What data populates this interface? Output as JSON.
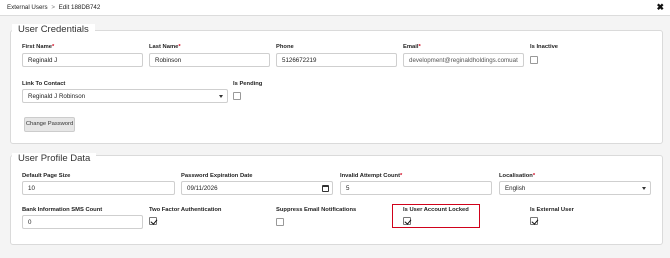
{
  "breadcrumb": {
    "root": "External Users",
    "separator": ">",
    "current": "Edit 188DB742"
  },
  "user_credentials": {
    "title": "User Credentials",
    "first_name": {
      "label": "First Name",
      "value": "Reginald J"
    },
    "last_name": {
      "label": "Last Name",
      "value": "Robinson"
    },
    "phone": {
      "label": "Phone",
      "value": "5126672219"
    },
    "email": {
      "label": "Email",
      "value": "development@reginaldholdings.comuat"
    },
    "is_inactive": {
      "label": "Is Inactive",
      "checked": false
    },
    "link_to_contact": {
      "label": "Link To Contact",
      "value": "Reginald J Robinson"
    },
    "is_pending": {
      "label": "Is Pending",
      "checked": false
    },
    "change_password_label": "Change Password",
    "required_mark": "*"
  },
  "user_profile": {
    "title": "User Profile Data",
    "default_page_size": {
      "label": "Default Page Size",
      "value": "10"
    },
    "password_expiration_date": {
      "label": "Password Expiration Date",
      "value": "09/11/2026"
    },
    "invalid_attempt_count": {
      "label": "Invalid Attempt Count",
      "value": "5"
    },
    "localisation": {
      "label": "Localisation",
      "value": "English"
    },
    "bank_info_sms_count": {
      "label": "Bank Information SMS Count",
      "value": "0"
    },
    "two_factor_auth": {
      "label": "Two Factor Authentication",
      "checked": true
    },
    "suppress_email_notifications": {
      "label": "Suppress Email Notifications",
      "checked": false
    },
    "is_user_account_locked": {
      "label": "Is User Account Locked",
      "checked": true
    },
    "is_external_user": {
      "label": "Is External User",
      "checked": true
    }
  },
  "colors": {
    "highlight": "#d0021b",
    "required": "#d0021b"
  }
}
